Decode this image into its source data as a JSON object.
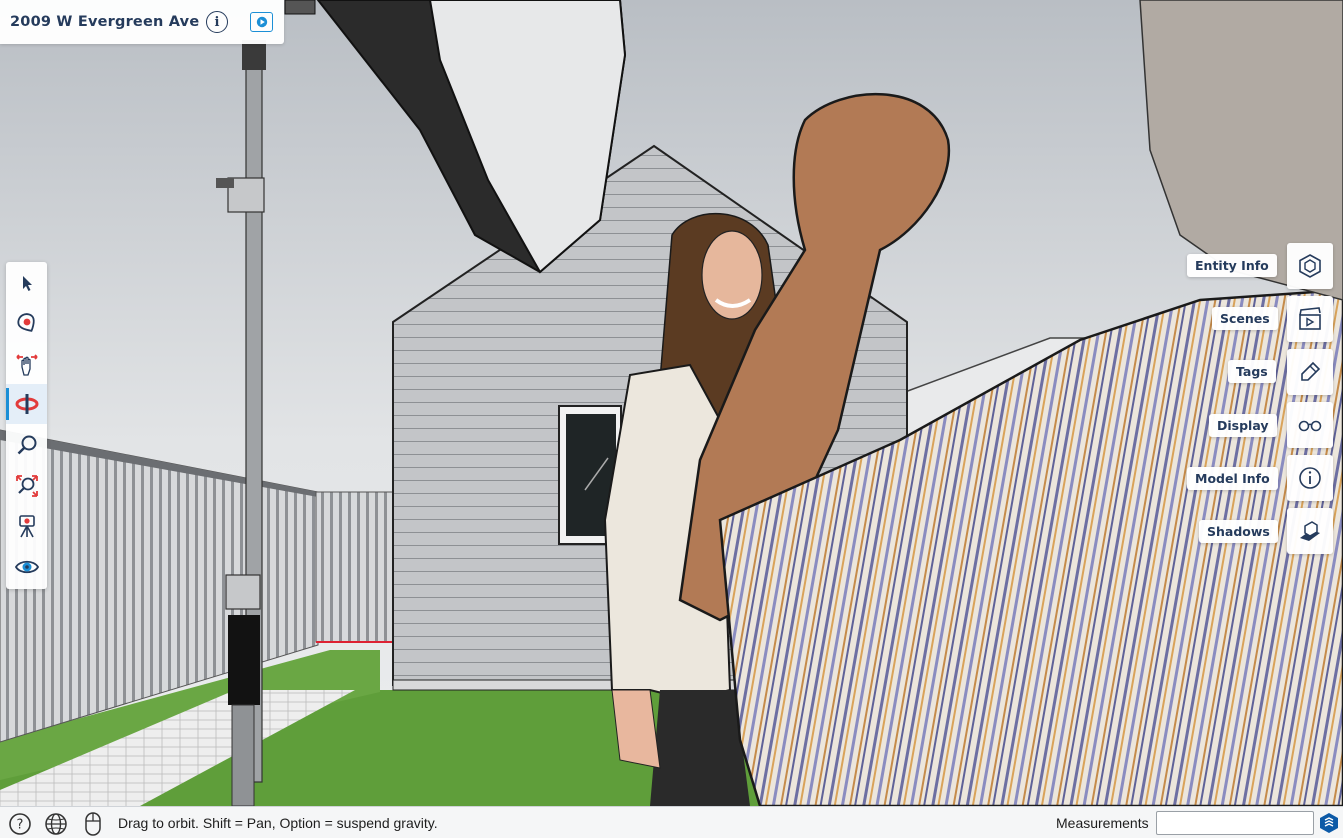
{
  "header": {
    "title": "2009 W Evergreen Ave",
    "model_info_icon": "info-circle-icon",
    "present_icon": "play-square-icon"
  },
  "left_toolbar": {
    "tools": [
      {
        "name": "select-tool",
        "icon": "arrow-cursor-icon"
      },
      {
        "name": "walk-tool",
        "icon": "pin-marker-icon"
      },
      {
        "name": "pan-tool",
        "icon": "hand-arrows-icon"
      },
      {
        "name": "orbit-tool",
        "icon": "orbit-icon",
        "active": true
      },
      {
        "name": "zoom-tool",
        "icon": "magnifier-icon"
      },
      {
        "name": "zoom-extents-tool",
        "icon": "zoom-extents-icon"
      },
      {
        "name": "position-camera-tool",
        "icon": "tripod-icon"
      },
      {
        "name": "look-around-tool",
        "icon": "eye-icon"
      }
    ]
  },
  "right_panels": [
    {
      "label": "Entity Info",
      "icon": "entity-cube-icon"
    },
    {
      "label": "Scenes",
      "icon": "clapperboard-icon"
    },
    {
      "label": "Tags",
      "icon": "tag-pencil-icon"
    },
    {
      "label": "Display",
      "icon": "glasses-icon"
    },
    {
      "label": "Model Info",
      "icon": "info-circle-icon"
    },
    {
      "label": "Shadows",
      "icon": "shadow-box-icon"
    }
  ],
  "status_bar": {
    "hint": "Drag to orbit. Shift = Pan, Option = suspend gravity.",
    "measurements_label": "Measurements",
    "measurements_value": "",
    "icons": [
      "help-icon",
      "globe-icon",
      "mouse-icon",
      "sketchup-logo-icon"
    ]
  },
  "colors": {
    "brand_navy": "#253b5c",
    "accent_blue": "#1c8fd6",
    "tool_red": "#e23b3b",
    "grass": "#5f9e3a"
  }
}
